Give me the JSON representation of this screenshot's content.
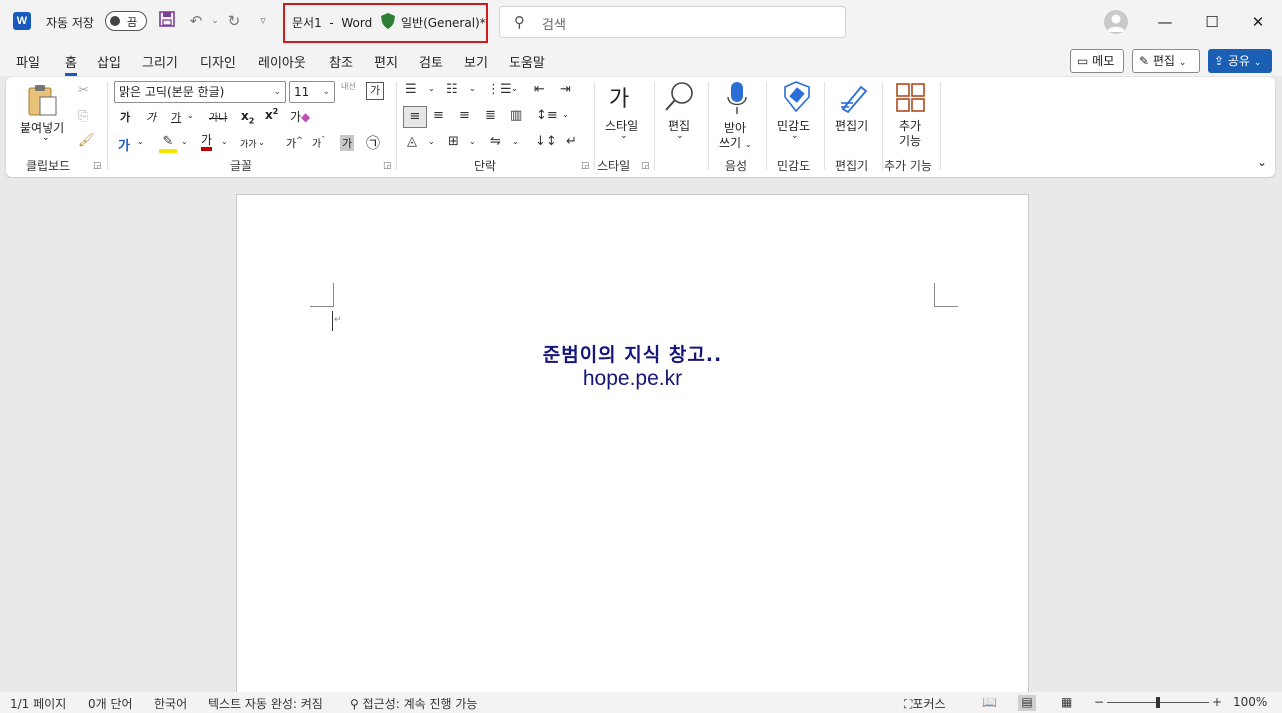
{
  "titlebar": {
    "autosave_label": "자동 저장",
    "autosave_state": "끔",
    "document_name": "문서1",
    "separator": "-",
    "app_name": "Word",
    "sensitivity_label": "일반(General)*",
    "search_placeholder": "검색"
  },
  "menu": {
    "tabs": [
      "파일",
      "홈",
      "삽입",
      "그리기",
      "디자인",
      "레이아웃",
      "참조",
      "편지",
      "검토",
      "보기",
      "도움말"
    ],
    "active_tab": "홈",
    "comments_label": "메모",
    "editing_label": "편집",
    "share_label": "공유"
  },
  "ribbon": {
    "clipboard": {
      "paste_label": "붙여넣기",
      "group_label": "클립보드"
    },
    "font": {
      "font_name": "맑은 고딕(본문 한글)",
      "font_size": "11",
      "phonetic_label": "내선",
      "bold": "가",
      "italic": "가",
      "underline": "가",
      "strike": "가나",
      "subscript": "x",
      "superscript": "x",
      "clear_label": "가",
      "text_effect": "가",
      "font_color": "가",
      "char_scale": "가가",
      "grow": "가",
      "shrink": "가",
      "shade": "가",
      "enclose": "㉠",
      "group_label": "글꼴"
    },
    "paragraph": {
      "group_label": "단락"
    },
    "styles": {
      "style_icon": "가",
      "style_label": "스타일",
      "group_label": "스타일"
    },
    "editing": {
      "label": "편집"
    },
    "voice": {
      "dictate_line1": "받아",
      "dictate_line2": "쓰기",
      "group_label": "음성"
    },
    "sensitivity": {
      "label": "민감도",
      "group_label": "민감도"
    },
    "editor": {
      "label": "편집기",
      "group_label": "편집기"
    },
    "addins": {
      "line1": "추가",
      "line2": "기능",
      "group_label": "추가 기능"
    }
  },
  "document": {
    "line1": "준범이의 지식 창고..",
    "line2": "hope.pe.kr",
    "text_color": "#16167a"
  },
  "statusbar": {
    "page": "1/1 페이지",
    "words": "0개 단어",
    "language": "한국어",
    "autocomplete": "텍스트 자동 완성: 켜짐",
    "accessibility": "접근성: 계속 진행 가능",
    "focus": "포커스",
    "zoom": "100%"
  },
  "colors": {
    "accent": "#185abd",
    "highlight_box": "#d11a1a",
    "share_button": "#1a5fb4"
  }
}
